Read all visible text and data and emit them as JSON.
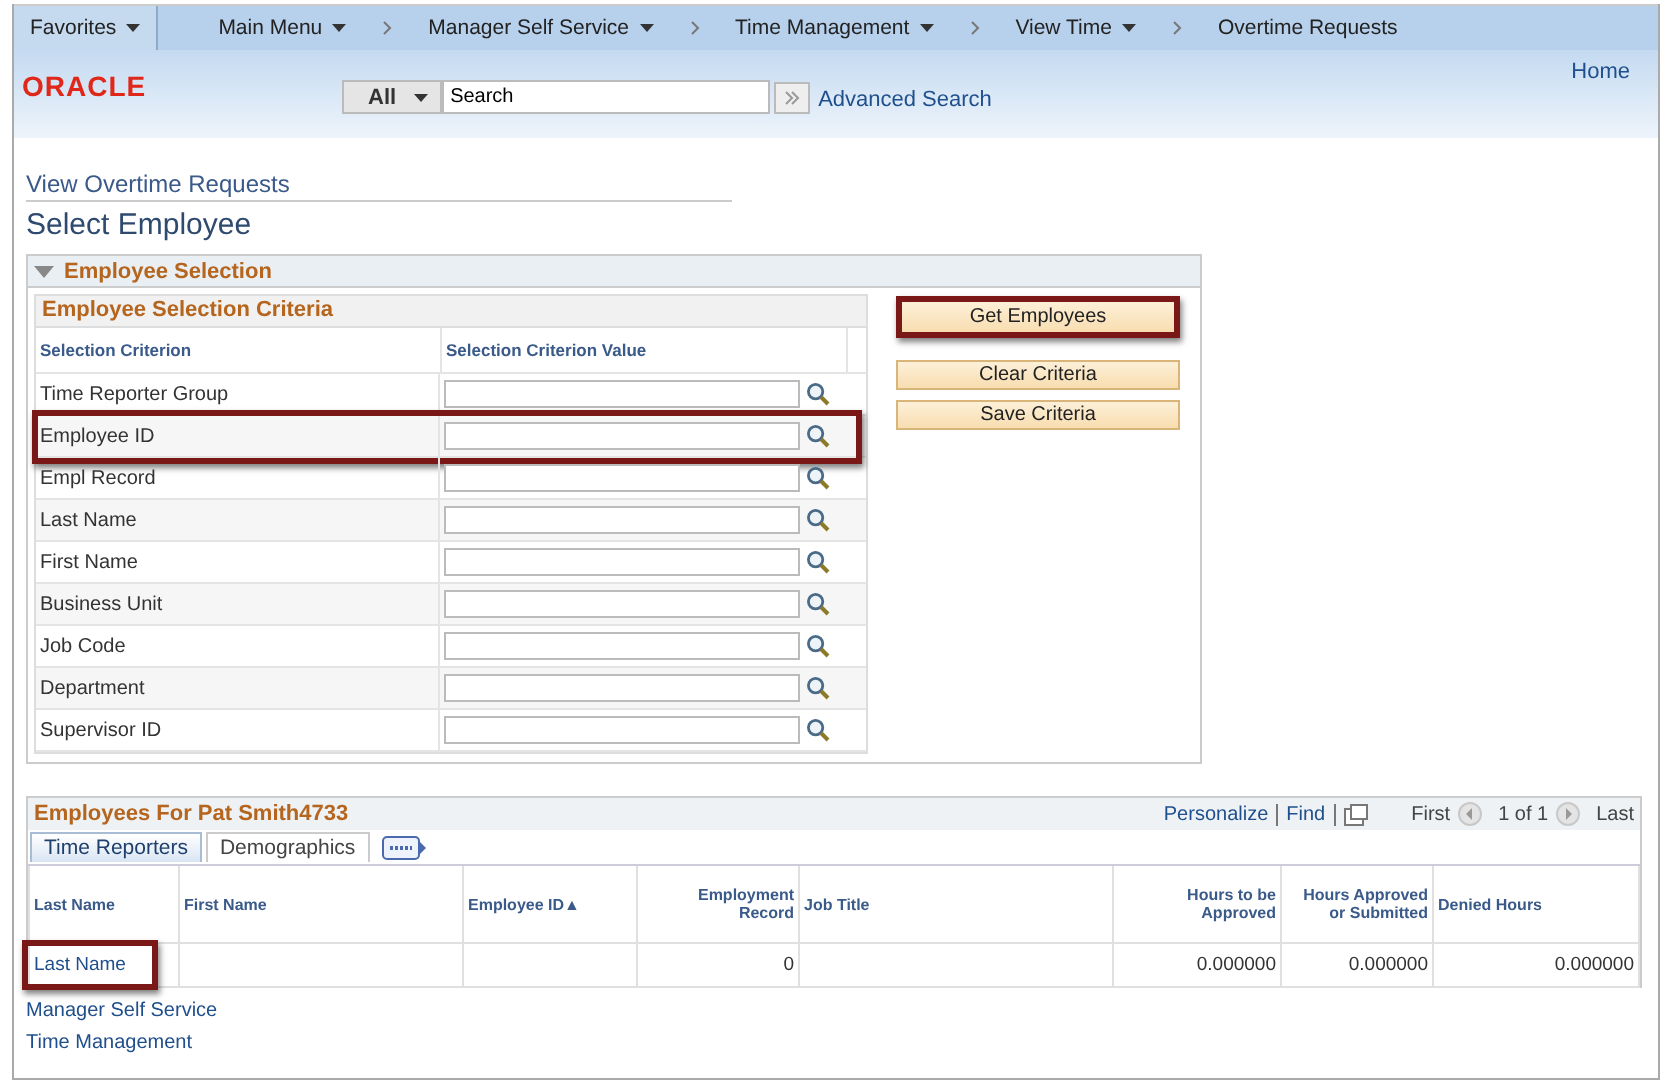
{
  "nav": [
    {
      "label": "Favorites",
      "dropdown": true,
      "kind": "favorites"
    },
    {
      "label": "Main Menu",
      "dropdown": true,
      "kind": "root"
    },
    {
      "label": "Manager Self Service",
      "dropdown": true,
      "kind": "crumb"
    },
    {
      "label": "Time Management",
      "dropdown": true,
      "kind": "crumb"
    },
    {
      "label": "View Time",
      "dropdown": true,
      "kind": "crumb"
    },
    {
      "label": "Overtime Requests",
      "dropdown": false,
      "kind": "crumb"
    }
  ],
  "header": {
    "logo": "ORACLE",
    "home": "Home",
    "scope": "All",
    "search": {
      "value": "Search"
    },
    "advanced": "Advanced Search"
  },
  "breadcrumb": "View Overtime Requests",
  "page_title": "Select Employee",
  "section": {
    "title": "Employee Selection",
    "expanded": true,
    "criteria": {
      "title": "Employee Selection Criteria",
      "columns": [
        "Selection Criterion",
        "Selection Criterion Value"
      ],
      "rows": [
        {
          "label": "Time Reporter Group",
          "highlighted": false
        },
        {
          "label": "Employee ID",
          "highlighted": true
        },
        {
          "label": "Empl Record",
          "highlighted": false
        },
        {
          "label": "Last Name",
          "highlighted": false
        },
        {
          "label": "First Name",
          "highlighted": false
        },
        {
          "label": "Business Unit",
          "highlighted": false
        },
        {
          "label": "Job Code",
          "highlighted": false
        },
        {
          "label": "Department",
          "highlighted": false
        },
        {
          "label": "Supervisor ID",
          "highlighted": false
        }
      ]
    },
    "buttons": [
      {
        "label": "Get Employees",
        "highlighted": true
      },
      {
        "label": "Clear Criteria",
        "highlighted": false
      },
      {
        "label": "Save Criteria",
        "highlighted": false
      }
    ]
  },
  "results": {
    "title": "Employees For Pat Smith4733",
    "personalize": "Personalize",
    "find": "Find",
    "first": "First",
    "count": "1 of 1",
    "last": "Last",
    "tabs": [
      {
        "label": "Time Reporters",
        "selected": true
      },
      {
        "label": "Demographics",
        "selected": false
      }
    ],
    "columns": [
      "Last Name",
      "First Name",
      "Employee ID▲",
      "Employment Record",
      "Job Title",
      "Hours to be Approved",
      "Hours Approved or Submitted",
      "Denied Hours"
    ],
    "rows": [
      {
        "cells": [
          {
            "text": "Last Name",
            "kind": "link",
            "highlighted": true
          },
          {
            "kind": "text",
            "highlighted": false
          },
          {
            "kind": "text",
            "highlighted": false
          },
          {
            "text": "0",
            "kind": "number",
            "highlighted": false
          },
          {
            "kind": "text",
            "highlighted": false
          },
          {
            "text": "0.000000",
            "kind": "number",
            "highlighted": false
          },
          {
            "text": "0.000000",
            "kind": "number",
            "highlighted": false
          },
          {
            "text": "0.000000",
            "kind": "number",
            "highlighted": false
          }
        ]
      }
    ]
  },
  "footer_links": [
    "Manager Self Service",
    "Time Management"
  ]
}
